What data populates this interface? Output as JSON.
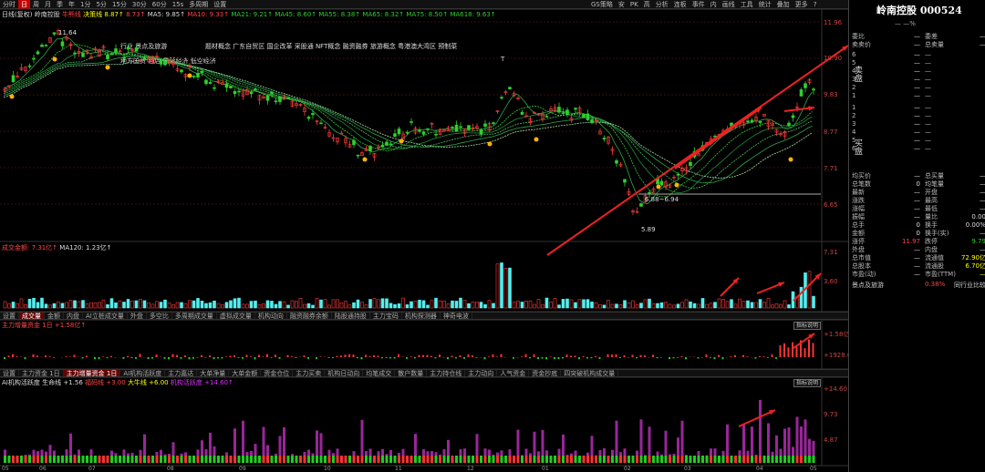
{
  "toolbar": {
    "periods": [
      "分时",
      "日",
      "周",
      "月",
      "季",
      "年",
      "1分",
      "5分",
      "15分",
      "30分",
      "60分",
      "15s",
      "多周期",
      "设置"
    ],
    "active": "日",
    "right_items": [
      "GS策略",
      "安",
      "PK",
      "高",
      "分析",
      "连板",
      "事件",
      "内",
      "画线",
      "工具",
      "统计",
      "叠加",
      "更多",
      "?"
    ]
  },
  "price_legend": {
    "label": "日线(复权)",
    "name": "岭南控股",
    "indicator": "牛熊线",
    "ind2": "决策线",
    "v1": "8.87↑",
    "v2": "8.73↑",
    "ma5": "MA5: 9.85↑",
    "ma10": "MA10: 9.33↑",
    "ma21": "MA21: 9.21↑",
    "ma45": "MA45: 8.60↑",
    "ma55": "MA55: 8.38↑",
    "ma65": "MA65: 8.32↑",
    "ma75": "MA75: 8.50↑",
    "ma618": "MA618: 9.63↑"
  },
  "tags": [
    [
      "行业",
      "景点及旅游"
    ],
    [
      "题材概念",
      "广东自贸区",
      "国企改革",
      "采股通",
      "NFT概念",
      "融资融券",
      "旅游概念",
      "粤港澳大湾区",
      "预制菜"
    ],
    [
      "地方国资",
      "酒店",
      "露营经济",
      "低空经济"
    ]
  ],
  "price_scale": [
    "11.96",
    "10.90",
    "9.83",
    "8.77",
    "7.71",
    "6.65"
  ],
  "price_marks": {
    "high": "11.64",
    "low": "5.89",
    "cost": "6.88~6.94",
    "t": "T"
  },
  "date_axis": [
    "05",
    "06",
    "07",
    "08",
    "09",
    "10",
    "11",
    "12",
    "01",
    "02",
    "03",
    "04",
    "05"
  ],
  "volume_legend": {
    "label": "成交金额:",
    "v": "7.31亿↑",
    "ma": "MA120: 1.23亿↑"
  },
  "volume_scale": [
    "7.31",
    "3.60"
  ],
  "tabs1": [
    "设置",
    "成交量",
    "金额",
    "内盘",
    "AI立桩成交量",
    "外盘",
    "多空比",
    "多周期成交量",
    "虚拟成交量",
    "机构动向",
    "融资融券余额",
    "陆股通持股",
    "主力宝码",
    "机构探测器",
    "神奇电波"
  ],
  "tabs1_active": "成交量",
  "flow_legend": {
    "label": "主力增量资金 1日",
    "v": "+1.58亿↑"
  },
  "flow_scale": [
    "+1.58亿",
    "+1928.00"
  ],
  "tabs2": [
    "设置",
    "主力资金 1日",
    "主力增量资金 1日",
    "AI机构活跃度",
    "主力嘉达",
    "大单净量",
    "大单金额",
    "资金仓位",
    "主力买卖",
    "机构日动向",
    "均笔成交",
    "散户数量",
    "主力持仓线",
    "主力动向",
    "人气资金",
    "资金抄底",
    "四突破机构成交量"
  ],
  "tabs2_active": "主力增量资金 1日",
  "ai_legend": {
    "label": "AI机构活跃度",
    "v0": "生命线",
    "v1": "+1.56",
    "s2": "福码线",
    "v2": "+3.00",
    "s3": "大牛线",
    "v3": "+6.00",
    "s4": "机构活跃度",
    "v4": "+14.60↑"
  },
  "ai_scale": [
    "+14.60",
    "9.73",
    "4.87"
  ],
  "indicator_btn": "指标说明",
  "quote": {
    "title": "岭南控股 000524",
    "subtitle": "—  —%",
    "rows_top": [
      [
        "委比",
        "—",
        "委差",
        "—"
      ],
      [
        "卖卖价",
        "—",
        "总卖量",
        "—"
      ]
    ],
    "sell": [
      [
        "6",
        "—",
        "—"
      ],
      [
        "5",
        "—",
        "—"
      ],
      [
        "4",
        "—",
        "—"
      ],
      [
        "3",
        "—",
        "—"
      ],
      [
        "2",
        "—",
        "—"
      ],
      [
        "1",
        "—",
        "—"
      ]
    ],
    "sell_side": "卖盘",
    "buy": [
      [
        "1",
        "—",
        "—"
      ],
      [
        "2",
        "—",
        "—"
      ],
      [
        "3",
        "—",
        "—"
      ],
      [
        "4",
        "—",
        "—"
      ],
      [
        "5",
        "—",
        "—"
      ],
      [
        "6",
        "—",
        "—"
      ]
    ],
    "buy_side": "买盘",
    "stats": [
      [
        "均买价",
        "—",
        "总买量",
        "—"
      ],
      [
        "总笔数",
        "0",
        "均笔量",
        "—"
      ],
      [
        "最新",
        "—",
        "开盘",
        "—"
      ],
      [
        "涨跌",
        "—",
        "最高",
        "—"
      ],
      [
        "涨幅",
        "—",
        "最低",
        "—"
      ],
      [
        "振幅",
        "—",
        "量比",
        "0.00"
      ],
      [
        "总手",
        "0",
        "换手",
        "0.00%"
      ],
      [
        "金额",
        "0",
        "换手(实)",
        "—"
      ],
      [
        "涨停",
        "11.97",
        "跌停",
        "9.79"
      ],
      [
        "外盘",
        "—",
        "内盘",
        "—"
      ],
      [
        "总市值",
        "—",
        "流通值",
        "72.90亿"
      ],
      [
        "总股本",
        "—",
        "流通股",
        "6.70亿"
      ],
      [
        "市盈(动)",
        "—",
        "市盈(TTM)",
        "—"
      ]
    ],
    "footer": [
      "景点及旅游",
      "0.38%",
      "同行业比较"
    ]
  },
  "colors": {
    "up": "#ff3b3b",
    "down": "#2ed12e",
    "ma": "#2ea84a",
    "accent": "#ffd200"
  }
}
